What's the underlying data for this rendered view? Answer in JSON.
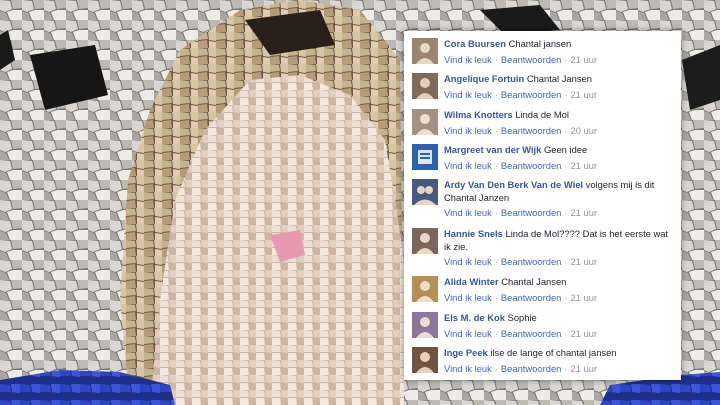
{
  "comments": [
    {
      "name": "Cora Buursen",
      "text": "Chantal jansen",
      "like": "Vind ik leuk",
      "reply": "Beantwoorden",
      "time": "21 uur",
      "avatar_color": "#9c8570"
    },
    {
      "name": "Angelique Fortuin",
      "text": "Chantal Jansen",
      "like": "Vind ik leuk",
      "reply": "Beantwoorden",
      "time": "21 uur",
      "avatar_color": "#7f6b5a"
    },
    {
      "name": "Wilma Knotters",
      "text": "Linda de Mol",
      "like": "Vind ik leuk",
      "reply": "Beantwoorden",
      "time": "20 uur",
      "avatar_color": "#a19281"
    },
    {
      "name": "Margreet van der Wijk",
      "text": "Geen idee",
      "like": "Vind ik leuk",
      "reply": "Beantwoorden",
      "time": "21 uur",
      "avatar_color": "#2f62a8"
    },
    {
      "name": "Ardy Van Den Berk Van de Wiel",
      "text": "volgens mij is dit Chantal Janzen",
      "like": "Vind ik leuk",
      "reply": "Beantwoorden",
      "time": "21 uur",
      "avatar_color": "#485a80"
    },
    {
      "name": "Hannie Snels",
      "text": "Linda de Mol???? Dat is het eerste wat ik zie.",
      "like": "Vind ik leuk",
      "reply": "Beantwoorden",
      "time": "21 uur",
      "avatar_color": "#7a665c"
    },
    {
      "name": "Alida Winter",
      "text": "Chantal Jansen",
      "like": "Vind ik leuk",
      "reply": "Beantwoorden",
      "time": "21 uur",
      "avatar_color": "#b39056"
    },
    {
      "name": "Els M. de Kok",
      "text": "Sophie",
      "like": "Vind ik leuk",
      "reply": "Beantwoorden",
      "time": "21 uur",
      "avatar_color": "#8a7799"
    },
    {
      "name": "Inge Peek",
      "text": "ilse de lange of chantal jansen",
      "like": "Vind ik leuk",
      "reply": "Beantwoorden",
      "time": "21 uur",
      "avatar_color": "#6f5443"
    }
  ]
}
